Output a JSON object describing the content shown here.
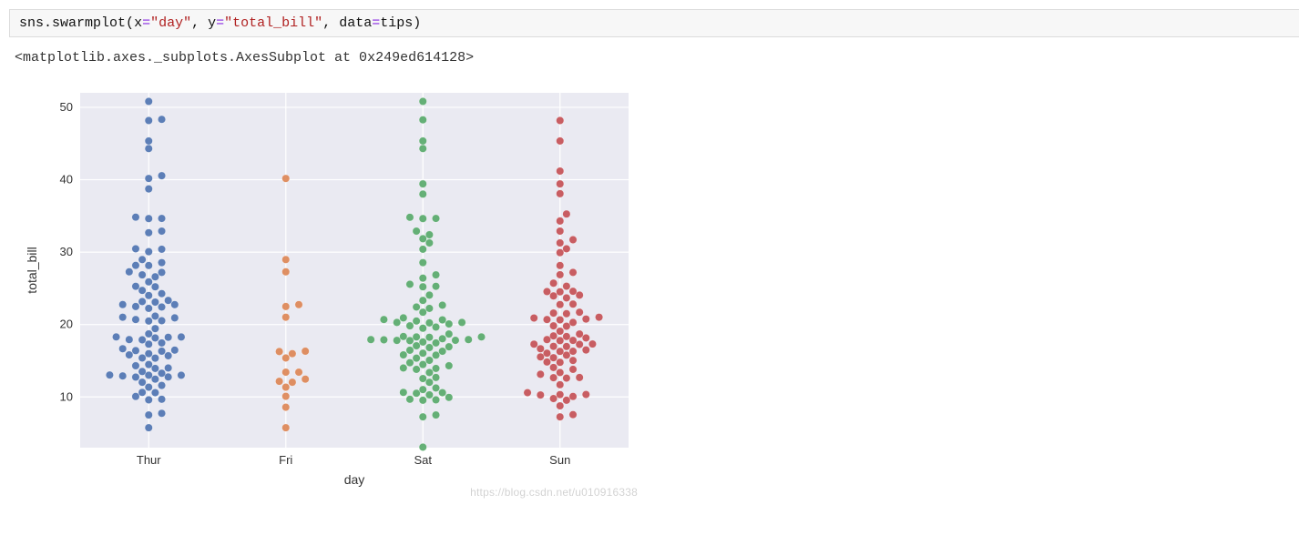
{
  "code": {
    "module": "sns",
    "dot": ".",
    "func": "swarmplot",
    "open": "(",
    "x_key": "x",
    "eq": "=",
    "x_val": "\"day\"",
    "comma": ", ",
    "y_key": "y",
    "y_val": "\"total_bill\"",
    "data_key": "data",
    "data_val": "tips",
    "close": ")"
  },
  "output_repr": "<matplotlib.axes._subplots.AxesSubplot at 0x249ed614128>",
  "watermark": "https://blog.csdn.net/u010916338",
  "chart_data": {
    "type": "swarm",
    "xlabel": "day",
    "ylabel": "total_bill",
    "categories": [
      "Thur",
      "Fri",
      "Sat",
      "Sun"
    ],
    "ylim": [
      3,
      52
    ],
    "yticks": [
      10,
      20,
      30,
      40,
      50
    ],
    "grid": true,
    "colors": {
      "Thur": "#4c72b0",
      "Fri": "#dd8452",
      "Sat": "#55a868",
      "Sun": "#c44e52"
    },
    "series": [
      {
        "name": "Thur",
        "values": [
          27.2,
          22.76,
          17.29,
          19.44,
          16.66,
          10.07,
          32.68,
          15.98,
          34.83,
          13.03,
          18.28,
          24.71,
          21.16,
          28.97,
          22.49,
          5.75,
          16.32,
          22.75,
          40.17,
          27.28,
          12.03,
          21.01,
          12.46,
          11.35,
          15.38,
          44.3,
          22.42,
          20.92,
          15.36,
          20.49,
          25.21,
          18.24,
          14.31,
          14.0,
          7.51,
          10.59,
          10.63,
          50.81,
          15.81,
          26.59,
          38.73,
          24.27,
          12.76,
          30.06,
          25.28,
          24.01,
          13.0,
          13.51,
          18.71,
          12.74,
          13.0,
          16.4,
          20.53,
          16.47,
          32.9,
          17.89,
          14.48,
          9.6,
          34.63,
          34.65,
          23.33,
          45.35,
          23.17,
          40.55,
          20.69,
          30.46,
          18.15,
          23.1,
          15.69,
          26.86,
          25.89,
          48.33,
          13.27,
          28.17,
          12.9,
          28.15,
          11.59,
          7.74,
          48.17,
          17.46,
          13.94,
          9.68,
          30.4,
          18.29,
          22.23,
          17.92,
          28.55
        ]
      },
      {
        "name": "Fri",
        "values": [
          28.97,
          22.49,
          5.75,
          16.32,
          22.75,
          40.17,
          27.28,
          12.03,
          21.01,
          12.46,
          11.35,
          15.38,
          13.42,
          15.98,
          16.27,
          10.09,
          12.16,
          8.58,
          13.42
        ]
      },
      {
        "name": "Sat",
        "values": [
          20.65,
          17.92,
          20.29,
          15.77,
          39.42,
          19.82,
          17.81,
          13.37,
          12.69,
          21.7,
          19.65,
          9.55,
          18.35,
          15.06,
          20.69,
          17.78,
          24.06,
          16.31,
          16.93,
          18.69,
          31.27,
          16.04,
          17.46,
          13.94,
          9.68,
          30.4,
          18.29,
          22.23,
          32.4,
          28.55,
          18.04,
          12.54,
          10.29,
          34.81,
          9.94,
          25.56,
          19.49,
          38.01,
          26.41,
          11.24,
          48.27,
          20.29,
          13.81,
          11.02,
          18.29,
          17.59,
          20.08,
          16.45,
          3.07,
          20.23,
          12.02,
          17.07,
          26.86,
          25.28,
          14.73,
          10.51,
          17.92,
          44.3,
          22.42,
          20.92,
          15.36,
          20.49,
          25.21,
          18.24,
          14.31,
          14.0,
          7.51,
          10.59,
          10.63,
          50.81,
          15.81,
          7.25,
          31.85,
          16.82,
          32.9,
          17.89,
          14.48,
          9.6,
          34.63,
          34.65,
          23.33,
          45.35,
          22.67,
          17.82
        ]
      },
      {
        "name": "Sun",
        "values": [
          16.99,
          10.34,
          21.01,
          23.68,
          24.59,
          25.29,
          8.77,
          26.88,
          15.04,
          14.78,
          10.27,
          35.26,
          15.42,
          18.43,
          14.83,
          21.58,
          10.33,
          16.29,
          16.97,
          20.65,
          17.92,
          20.29,
          15.77,
          39.42,
          19.82,
          17.81,
          13.37,
          12.69,
          21.7,
          9.55,
          18.35,
          17.78,
          24.06,
          16.31,
          18.69,
          31.27,
          16.04,
          38.07,
          23.95,
          25.71,
          17.31,
          29.93,
          14.07,
          13.13,
          17.26,
          24.55,
          19.77,
          48.17,
          16.49,
          21.5,
          12.66,
          13.81,
          24.52,
          20.76,
          31.71,
          20.69,
          7.25,
          10.59,
          30.46,
          32.9,
          22.82,
          19.08,
          34.3,
          41.19,
          9.78,
          7.56,
          18.15,
          45.35,
          20.9,
          28.15,
          11.69,
          15.53,
          10.07,
          12.6,
          27.2,
          22.76,
          17.29,
          16.66
        ]
      }
    ]
  }
}
